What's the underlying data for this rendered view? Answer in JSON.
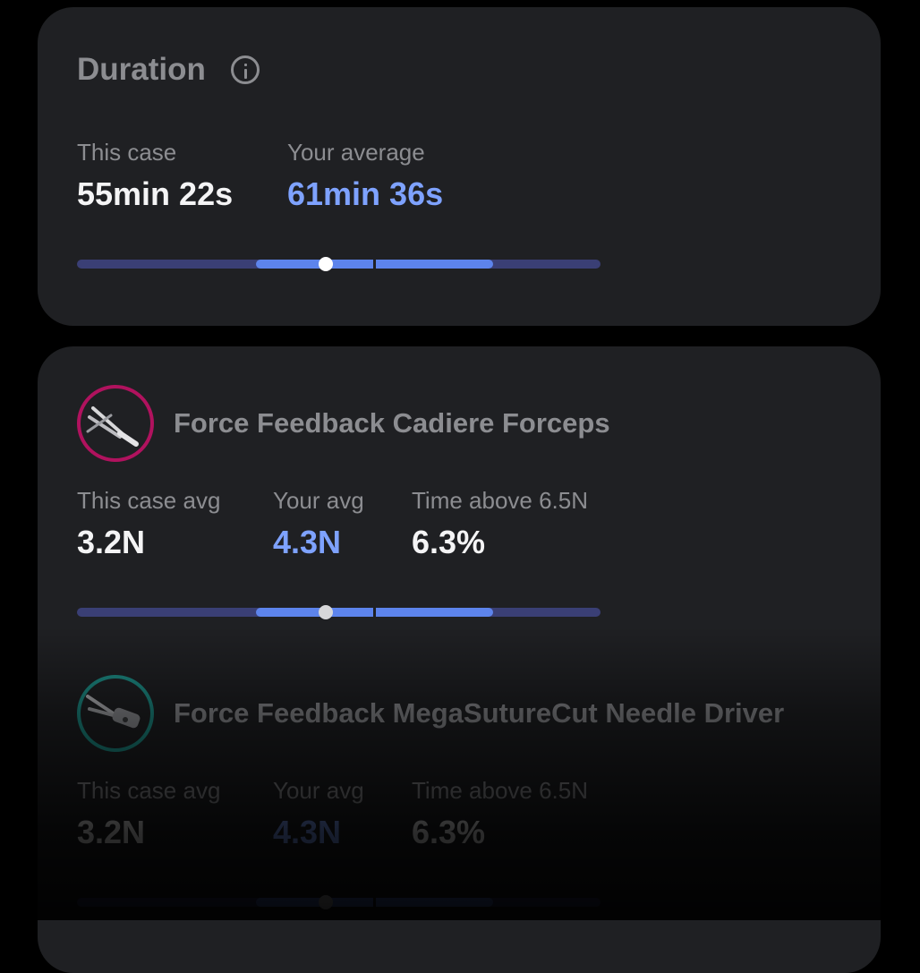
{
  "duration": {
    "title": "Duration",
    "this_case_label": "This case",
    "this_case_value": "55min 22s",
    "average_label": "Your average",
    "average_value": "61min 36s",
    "range": {
      "start": 0.342,
      "end": 0.795,
      "avg_marker": 0.568,
      "current": 0.475
    }
  },
  "tools": [
    {
      "name": "Force Feedback Cadiere Forceps",
      "icon_color": "#b0125e",
      "case_avg_label": "This case avg",
      "case_avg_value": "3.2N",
      "your_avg_label": "Your avg",
      "your_avg_value": "4.3N",
      "time_above_label": "Time above 6.5N",
      "time_above_value": "6.3%",
      "range": {
        "start": 0.342,
        "end": 0.795,
        "avg_marker": 0.568,
        "current": 0.475
      }
    },
    {
      "name": "Force Feedback MegaSutureCut Needle Driver",
      "icon_color": "#1d8d86",
      "case_avg_label": "This case avg",
      "case_avg_value": "3.2N",
      "your_avg_label": "Your avg",
      "your_avg_value": "4.3N",
      "time_above_label": "Time above 6.5N",
      "time_above_value": "6.3%",
      "range": {
        "start": 0.342,
        "end": 0.795,
        "avg_marker": 0.568,
        "current": 0.475
      }
    }
  ]
}
